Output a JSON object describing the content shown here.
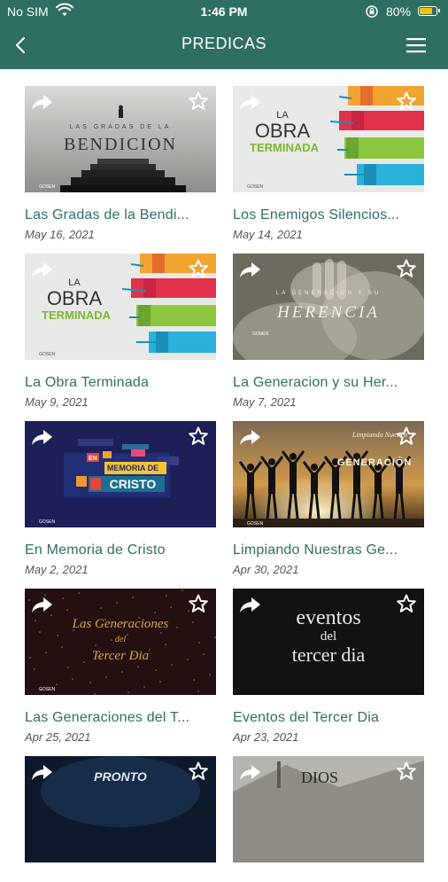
{
  "status": {
    "carrier": "No SIM",
    "time": "1:46 PM",
    "battery_pct": "80%",
    "battery_level": 0.8,
    "battery_color": "#f5c400"
  },
  "header": {
    "title": "PREDICAS",
    "back_icon": "chevron-left-icon",
    "menu_icon": "hamburger-icon",
    "color": "#2f6e63"
  },
  "sermons": [
    {
      "title": "Las Gradas de la Bendi...",
      "date": "May 16, 2021",
      "thumb_title": "BENDICION",
      "thumb_sub": "LAS GRADAS DE LA",
      "watermark": "GOSEN"
    },
    {
      "title": "Los Enemigos Silencios...",
      "date": "May 14, 2021",
      "thumb_title": "OBRA",
      "thumb_sub": "LA",
      "thumb_extra": "TERMINADA",
      "watermark": "GOSEN"
    },
    {
      "title": "La Obra Terminada",
      "date": "May 9, 2021",
      "thumb_title": "OBRA",
      "thumb_sub": "LA",
      "thumb_extra": "TERMINADA",
      "watermark": "GOSEN"
    },
    {
      "title": "La Generacion y su Her...",
      "date": "May 7, 2021",
      "thumb_title": "HERENCIA",
      "thumb_sub": "LA GENERACION Y SU",
      "watermark": "GOSEN"
    },
    {
      "title": "En Memoria de Cristo",
      "date": "May 2, 2021",
      "thumb_title": "CRISTO",
      "thumb_sub": "EN",
      "thumb_extra": "MEMORIA DE",
      "watermark": "GOSEN"
    },
    {
      "title": "Limpiando Nuestras Ge...",
      "date": "Apr 30, 2021",
      "thumb_title": "GENERACIÓN",
      "thumb_sub": "Limpiando Nuestra",
      "watermark": "GOSEN"
    },
    {
      "title": "Las Generaciones del T...",
      "date": "Apr 25, 2021",
      "thumb_title": "Las Generaciones",
      "thumb_sub": "del",
      "thumb_extra": "Tercer Dia",
      "watermark": "GOSEN"
    },
    {
      "title": "Eventos del Tercer Dia",
      "date": "Apr 23, 2021",
      "thumb_title": "eventos",
      "thumb_sub": "del",
      "thumb_extra": "tercer dia"
    },
    {
      "title": "",
      "date": "",
      "thumb_title": "PRONTO"
    },
    {
      "title": "",
      "date": "",
      "thumb_title": "DIOS"
    }
  ]
}
